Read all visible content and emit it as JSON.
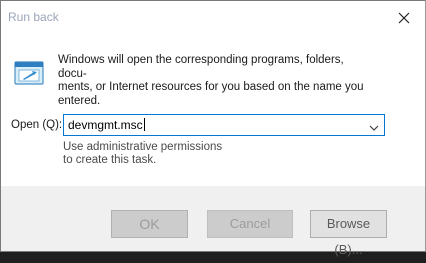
{
  "window": {
    "title": "Run back"
  },
  "dialog": {
    "description_lines": [
      "Windows will open the corresponding programs, folders, docu-",
      "ments, or Internet resources for you based on the name you",
      "entered."
    ],
    "open_label": "Open (Q):",
    "open_value": "devmgmt.msc",
    "admin_note_lines": [
      "Use administrative permissions",
      "to create this task."
    ]
  },
  "buttons": {
    "ok": "OK",
    "cancel": "Cancel",
    "browse": "Browse (B)..."
  },
  "icons": {
    "app": "run-dialog-icon",
    "close": "close-icon",
    "dropdown": "chevron-down-icon"
  },
  "colors": {
    "accent": "#0078d7",
    "title_text": "#9aa4b8"
  }
}
